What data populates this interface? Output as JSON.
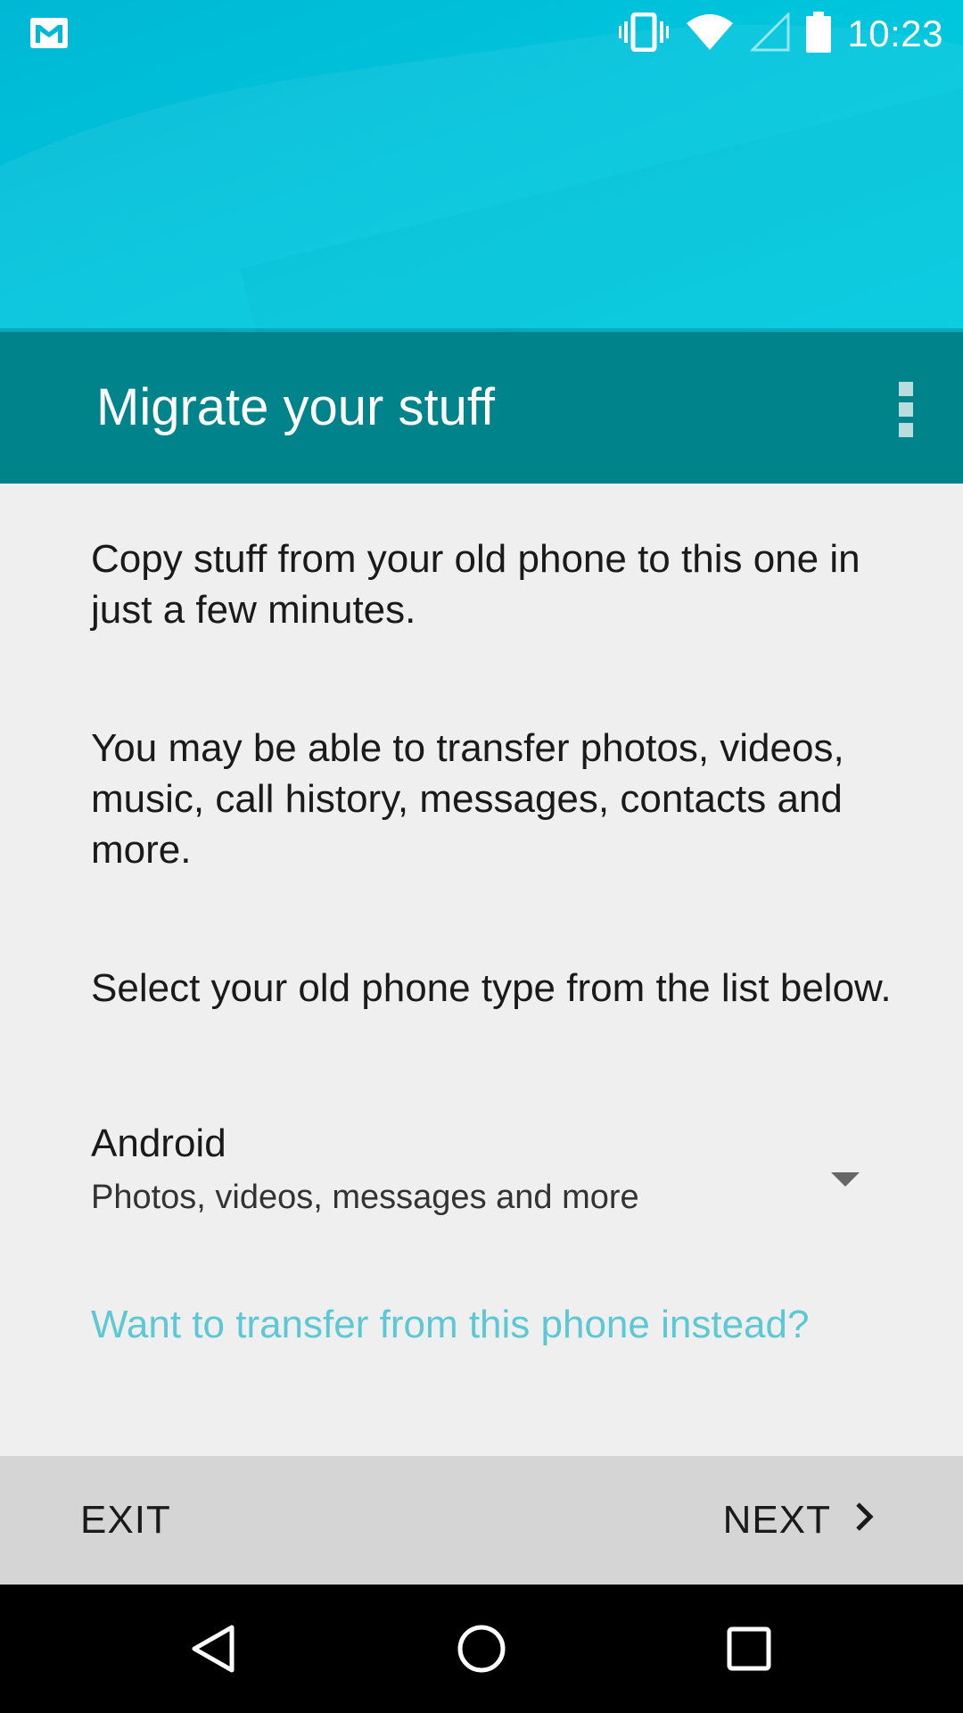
{
  "status_bar": {
    "time": "10:23",
    "icons": [
      "gmail-icon",
      "vibrate-icon",
      "wifi-icon",
      "cell-signal-icon",
      "battery-icon"
    ]
  },
  "header": {
    "title": "Migrate your stuff",
    "menu_icon": "overflow-menu-icon"
  },
  "main": {
    "intro": "Copy stuff from your old phone to this one in just a few minutes.",
    "details": "You may be able to transfer photos, videos, music, call history, messages, contacts and more.",
    "instruction": "Select your old phone type from the list below.",
    "phone_type": {
      "selected": "Android",
      "description": "Photos, videos, messages and more"
    },
    "transfer_link": "Want to transfer from this phone instead?"
  },
  "footer": {
    "exit_label": "EXIT",
    "next_label": "NEXT"
  },
  "nav": {
    "icons": [
      "back-icon",
      "home-icon",
      "recents-icon"
    ]
  },
  "colors": {
    "hero": "#00c4dc",
    "appbar": "#00838a",
    "link": "#5bc8d4",
    "footer": "#d5d5d5"
  }
}
